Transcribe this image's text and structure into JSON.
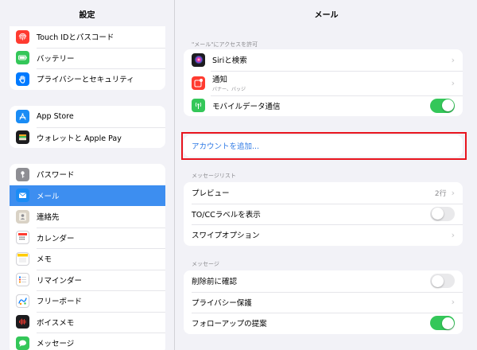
{
  "sidebar": {
    "title": "設定",
    "groups": [
      [
        {
          "label": "Touch IDとパスコード",
          "icon": "fingerprint-icon"
        },
        {
          "label": "バッテリー",
          "icon": "battery-icon"
        },
        {
          "label": "プライバシーとセキュリティ",
          "icon": "hand-icon"
        }
      ],
      [
        {
          "label": "App Store",
          "icon": "app-store-icon"
        },
        {
          "label": "ウォレットと Apple Pay",
          "icon": "wallet-icon"
        }
      ],
      [
        {
          "label": "パスワード",
          "icon": "key-icon"
        },
        {
          "label": "メール",
          "icon": "mail-icon",
          "selected": true
        },
        {
          "label": "連絡先",
          "icon": "contacts-icon"
        },
        {
          "label": "カレンダー",
          "icon": "calendar-icon"
        },
        {
          "label": "メモ",
          "icon": "notes-icon"
        },
        {
          "label": "リマインダー",
          "icon": "reminders-icon"
        },
        {
          "label": "フリーボード",
          "icon": "freeform-icon"
        },
        {
          "label": "ボイスメモ",
          "icon": "voice-memos-icon"
        },
        {
          "label": "メッセージ",
          "icon": "messages-icon"
        }
      ]
    ]
  },
  "main": {
    "title": "メール",
    "access_section": {
      "header": "\"メール\"にアクセスを許可",
      "rows": [
        {
          "title": "Siriと検索",
          "icon": "siri-icon"
        },
        {
          "title": "通知",
          "subtitle": "バナー、バッジ",
          "icon": "notifications-icon"
        },
        {
          "title": "モバイルデータ通信",
          "icon": "cellular-icon",
          "toggle": "on"
        }
      ]
    },
    "add_account_label": "アカウントを追加...",
    "message_list_section": {
      "header": "メッセージリスト",
      "rows": [
        {
          "title": "プレビュー",
          "value": "2行"
        },
        {
          "title": "TO/CCラベルを表示",
          "toggle": "off"
        },
        {
          "title": "スワイプオプション"
        }
      ]
    },
    "messages_section": {
      "header": "メッセージ",
      "rows": [
        {
          "title": "削除前に確認",
          "toggle": "off"
        },
        {
          "title": "プライバシー保護"
        },
        {
          "title": "フォローアップの提案",
          "toggle": "on"
        }
      ]
    }
  },
  "colors": {
    "accent": "#2f7ae5",
    "selected": "#3d8ef0",
    "toggle_on": "#34c759",
    "highlight": "#e8141e"
  }
}
